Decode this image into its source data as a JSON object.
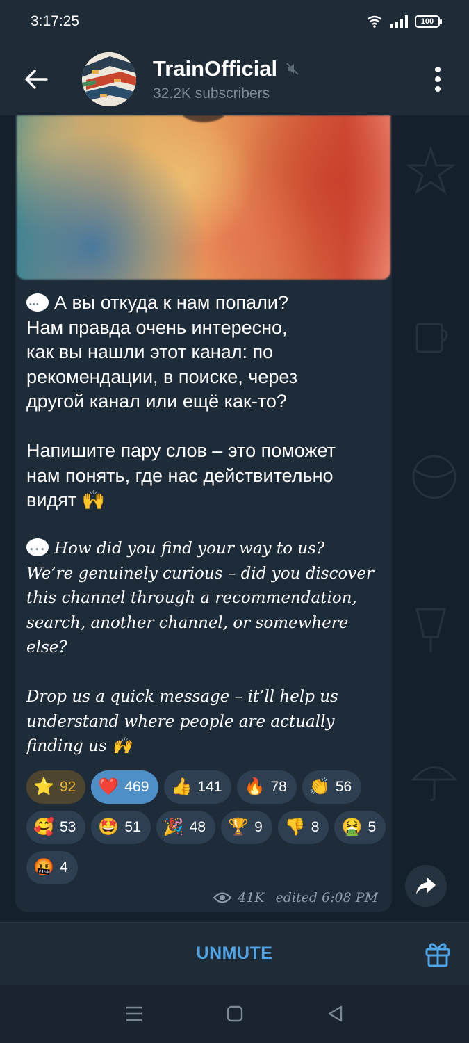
{
  "status_bar": {
    "time": "3:17:25",
    "battery": "100",
    "icons": [
      "wifi-icon",
      "signal-icon",
      "battery-icon"
    ]
  },
  "header": {
    "title": "TrainOfficial",
    "subtitle": "32.2K subscribers",
    "muted_icon": "muted-icon",
    "back_icon": "back-arrow-icon",
    "menu_icon": "more-vertical-icon"
  },
  "message": {
    "ru_text": "А вы откуда к нам попали?\nНам правда очень интересно,\nкак вы нашли этот канал: по\nрекомендации, в поиске, через\nдругой канал или ещё как-то?\n\nНапишите пару слов – это поможет\nнам понять, где нас действительно\nвидят 🙌",
    "en_text": "How did you find your way to us?\nWe’re genuinely curious – did you discover\nthis channel through a recommendation,\nsearch, another channel, or somewhere\nelse?\n\nDrop us a quick message – it’ll help us\nunderstand where people are actually\nfinding us 🙌",
    "views": "41K",
    "edited": "edited 6:08 PM"
  },
  "reactions": [
    {
      "emoji": "⭐",
      "count": "92",
      "kind": "paid"
    },
    {
      "emoji": "❤️",
      "count": "469",
      "kind": "selected"
    },
    {
      "emoji": "👍",
      "count": "141",
      "kind": "normal"
    },
    {
      "emoji": "🔥",
      "count": "78",
      "kind": "normal"
    },
    {
      "emoji": "👏",
      "count": "56",
      "kind": "normal"
    },
    {
      "emoji": "🥰",
      "count": "53",
      "kind": "normal"
    },
    {
      "emoji": "🤩",
      "count": "51",
      "kind": "normal"
    },
    {
      "emoji": "🎉",
      "count": "48",
      "kind": "normal"
    },
    {
      "emoji": "🏆",
      "count": "9",
      "kind": "normal"
    },
    {
      "emoji": "👎",
      "count": "8",
      "kind": "normal"
    },
    {
      "emoji": "🤮",
      "count": "5",
      "kind": "normal"
    },
    {
      "emoji": "🤬",
      "count": "4",
      "kind": "normal"
    }
  ],
  "bottom_bar": {
    "unmute_label": "UNMUTE",
    "gift_icon": "gift-icon"
  },
  "colors": {
    "accent": "#4ea4e6",
    "bubble": "#1e2c3a",
    "header": "#1f2b37",
    "paid_reaction": "#e6b43c"
  }
}
